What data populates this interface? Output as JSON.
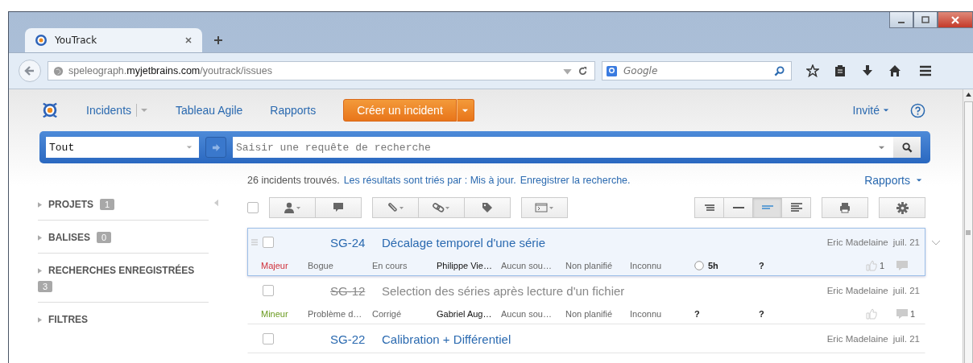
{
  "browser": {
    "tab": {
      "title": "YouTrack"
    },
    "url": {
      "subdomain": "speleograph.",
      "domain": "myjetbrains.com",
      "path": "/youtrack/issues"
    },
    "search_engine": {
      "placeholder": "Google"
    }
  },
  "nav": {
    "items": [
      {
        "label": "Incidents",
        "has_dropdown": true
      },
      {
        "label": "Tableau Agile",
        "has_dropdown": false
      },
      {
        "label": "Rapports",
        "has_dropdown": false
      }
    ],
    "create_button": "Créer un incident",
    "user": "Invité"
  },
  "search": {
    "context": "Tout",
    "placeholder": "Saisir une requête de recherche"
  },
  "summary": {
    "count": "26 incidents trouvés.",
    "sort_link": "Les résultats sont triés par : Mis à jour.",
    "save_link": "Enregistrer la recherche.",
    "reports": "Rapports"
  },
  "sidebar": {
    "sections": [
      {
        "label": "PROJETS",
        "count": "1"
      },
      {
        "label": "BALISES",
        "count": "0"
      },
      {
        "label": "RECHERCHES ENREGISTRÉES",
        "count": "3"
      },
      {
        "label": "FILTRES"
      }
    ]
  },
  "select_all": {
    "checked": false
  },
  "view_modes": [
    {
      "selected": false
    },
    {
      "selected": false
    },
    {
      "selected": true
    },
    {
      "selected": false
    }
  ],
  "issues": [
    {
      "id": "SG-24",
      "title": "Décalage temporel d'une série",
      "resolved": false,
      "selected": true,
      "checked": false,
      "author": "Eric Madelaine",
      "date": "juil. 21",
      "priority": {
        "label": "Majeur",
        "color": "#d0303a"
      },
      "fields": [
        "Bogue",
        "En cours",
        "Philippe Vie…",
        "Aucun sou…",
        "Non planifié",
        "Inconnu"
      ],
      "estimation": "5h",
      "spent": "?",
      "votes": "1"
    },
    {
      "id": "SG-12",
      "title": "Selection des séries après lecture d'un fichier",
      "resolved": true,
      "selected": false,
      "checked": false,
      "author": "Eric Madelaine",
      "date": "juil. 21",
      "priority": {
        "label": "Mineur",
        "color": "#6a9a1f"
      },
      "fields": [
        "Problème d…",
        "Corrigé",
        "Gabriel Aug…",
        "Aucun sou…",
        "Non planifié",
        "Inconnu"
      ],
      "estimation": "?",
      "spent": "?",
      "comments": "1"
    },
    {
      "id": "SG-22",
      "title": "Calibration + Différentiel",
      "resolved": false,
      "selected": false,
      "checked": false,
      "author": "Eric Madelaine",
      "date": "juil. 21"
    }
  ]
}
